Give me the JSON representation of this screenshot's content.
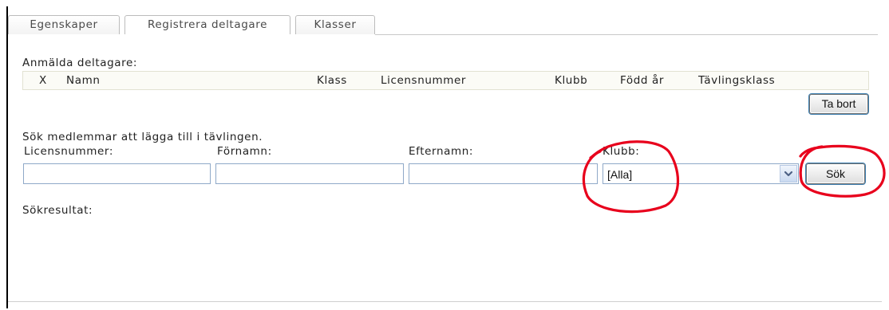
{
  "tabs": [
    {
      "label": "Egenskaper"
    },
    {
      "label": "Registrera deltagare"
    },
    {
      "label": "Klasser"
    }
  ],
  "registered": {
    "title": "Anmälda deltagare:",
    "columns": [
      "X",
      "Namn",
      "Klass",
      "Licensnummer",
      "Klubb",
      "Född år",
      "Tävlingsklass"
    ],
    "remove_button": "Ta bort"
  },
  "search": {
    "title": "Sök medlemmar att lägga till i tävlingen.",
    "license_label": "Licensnummer:",
    "license_value": "",
    "firstname_label": "Förnamn:",
    "firstname_value": "",
    "lastname_label": "Efternamn:",
    "lastname_value": "",
    "club_label": "Klubb:",
    "club_selected": "[Alla]",
    "search_button": "Sök"
  },
  "results": {
    "title": "Sökresultat:"
  },
  "colors": {
    "annotation": "#e8001c",
    "input_border": "#8fa9c8"
  }
}
